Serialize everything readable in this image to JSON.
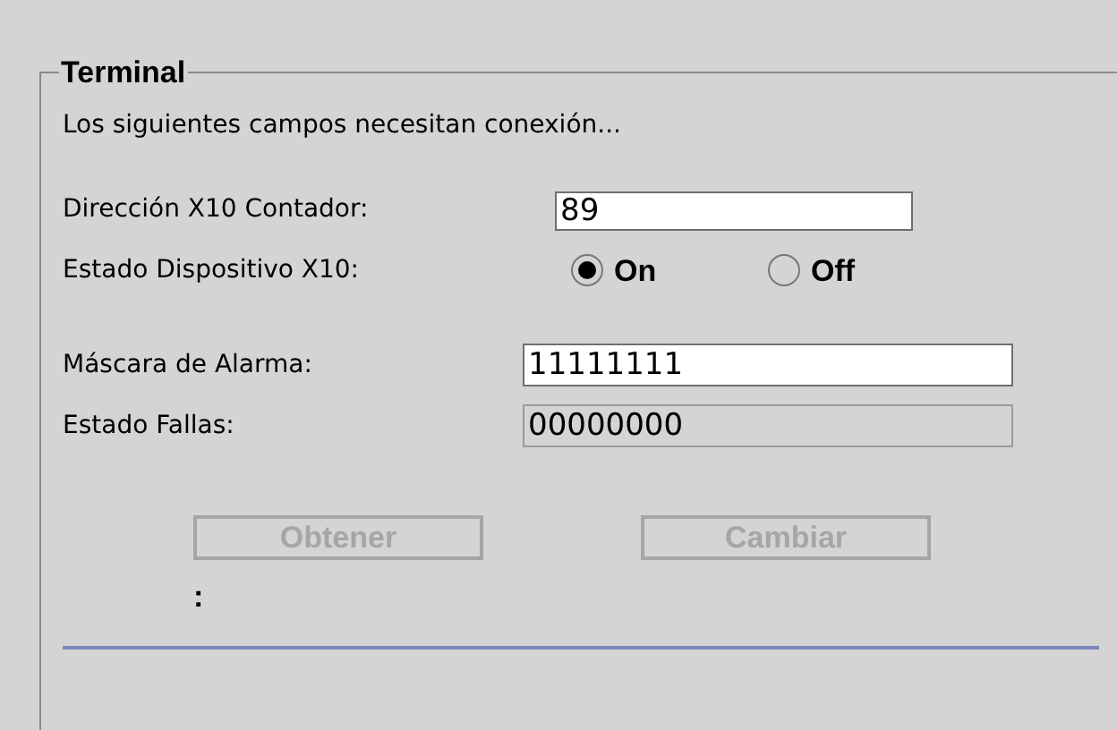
{
  "group": {
    "title": "Terminal"
  },
  "description": "Los siguientes campos necesitan conexión...",
  "address": {
    "label": "Dirección X10 Contador:",
    "value": "89"
  },
  "device_state": {
    "label": "Estado Dispositivo X10:",
    "options": [
      {
        "label": "On",
        "selected": true
      },
      {
        "label": "Off",
        "selected": false
      }
    ]
  },
  "mask": {
    "label": "Máscara de Alarma:",
    "value": "11111111",
    "disabled": false
  },
  "faults": {
    "label": "Estado Fallas:",
    "value": "00000000",
    "disabled": true
  },
  "buttons": [
    {
      "label": "Obtener",
      "disabled": true
    },
    {
      "label": "Cambiar",
      "disabled": true
    }
  ],
  "status": ":"
}
